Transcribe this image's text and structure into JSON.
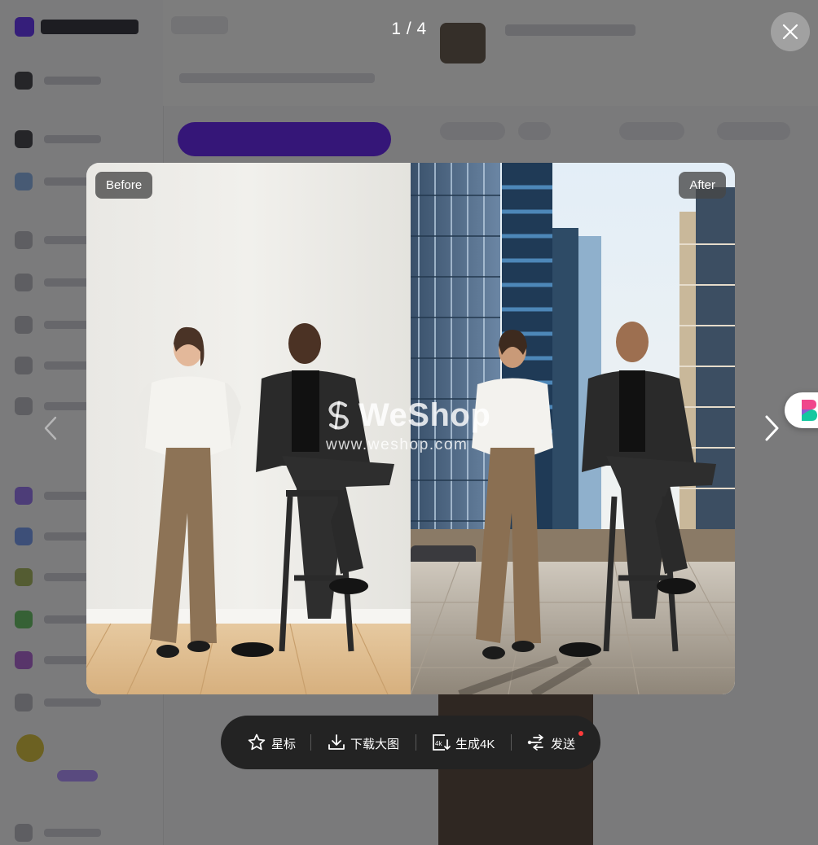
{
  "viewer": {
    "counter": "1 / 4",
    "before_label": "Before",
    "after_label": "After",
    "watermark_name": "WeShop",
    "watermark_url": "www.weshop.com"
  },
  "toolbar": {
    "star_label": "星标",
    "download_label": "下载大图",
    "generate_4k_label": "生成4K",
    "send_label": "发送"
  },
  "icons": {
    "close": "close-icon",
    "prev": "chevron-left-icon",
    "next": "chevron-right-icon",
    "star": "star-icon",
    "download": "download-icon",
    "generate_4k": "4k-icon",
    "send": "share-icon",
    "widget": "assistant-logo-icon"
  },
  "colors": {
    "toolbar_bg": "#232323",
    "tag_bg": "#464646",
    "notification_dot": "#ff3b3b",
    "widget_logo_pink": "#f0468c",
    "widget_logo_teal": "#14c8a0"
  }
}
